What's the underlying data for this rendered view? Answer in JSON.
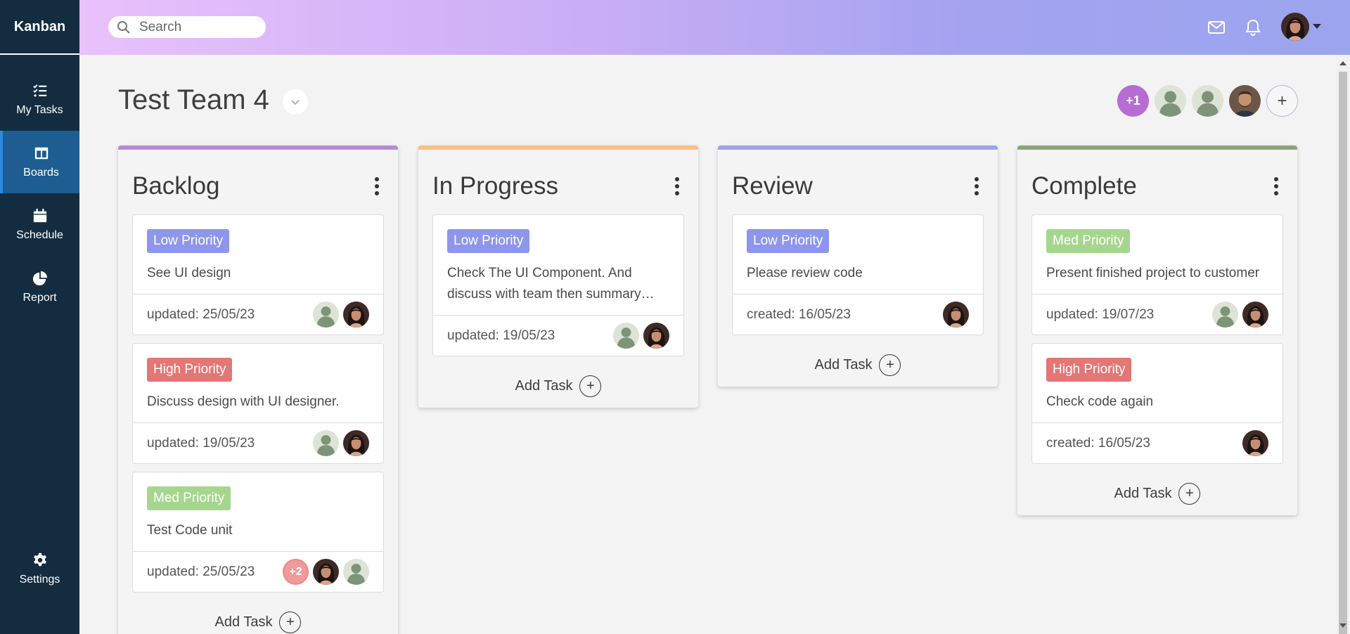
{
  "app": {
    "brand": "Kanban"
  },
  "sidebar": {
    "items": [
      {
        "label": "My Tasks",
        "icon": "task-list-icon",
        "active": false
      },
      {
        "label": "Boards",
        "icon": "board-icon",
        "active": true
      },
      {
        "label": "Schedule",
        "icon": "calendar-icon",
        "active": false
      },
      {
        "label": "Report",
        "icon": "pie-chart-icon",
        "active": false
      }
    ],
    "settings_label": "Settings"
  },
  "header": {
    "search_placeholder": "Search"
  },
  "team": {
    "title": "Test Team 4",
    "extra_members": "+1"
  },
  "add_task_label": "Add Task",
  "columns": [
    {
      "title": "Backlog",
      "accent": "#b98bd6",
      "cards": [
        {
          "priority": "Low Priority",
          "text": "See UI design",
          "date": "updated: 25/05/23"
        },
        {
          "priority": "High Priority",
          "text": "Discuss design with UI designer.",
          "date": "updated: 19/05/23"
        },
        {
          "priority": "Med Priority",
          "text": "Test Code unit",
          "date": "updated: 25/05/23",
          "extra": "+2"
        }
      ]
    },
    {
      "title": "In Progress",
      "accent": "#fbbf86",
      "cards": [
        {
          "priority": "Low Priority",
          "text": "Check The UI Component. And discuss with team then summary…",
          "date": "updated: 19/05/23"
        }
      ]
    },
    {
      "title": "Review",
      "accent": "#9ba2ee",
      "cards": [
        {
          "priority": "Low Priority",
          "text": "Please review code",
          "date": "created: 16/05/23"
        }
      ]
    },
    {
      "title": "Complete",
      "accent": "#8fa27a",
      "cards": [
        {
          "priority": "Med Priority",
          "text": "Present finished project to customer",
          "date": "updated: 19/07/23"
        },
        {
          "priority": "High Priority",
          "text": "Check code again",
          "date": "created: 16/05/23"
        }
      ]
    }
  ]
}
